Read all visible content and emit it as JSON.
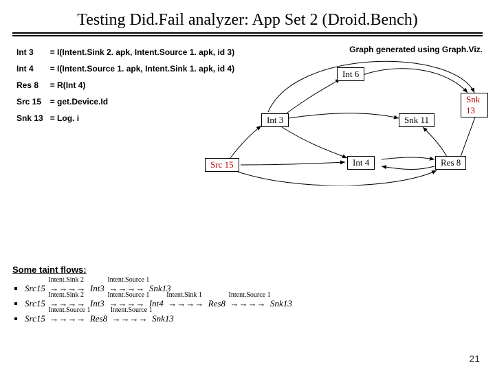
{
  "title": "Testing Did.Fail analyzer: App Set 2 (Droid.Bench)",
  "graph_caption": "Graph generated using Graph.Viz.",
  "defs": [
    {
      "name": "Int 3",
      "rhs": "= I(Intent.Sink 2. apk, Intent.Source 1. apk, id 3)"
    },
    {
      "name": "Int 4",
      "rhs": "= I(Intent.Source 1. apk, Intent.Sink 1. apk, id 4)"
    },
    {
      "name": "Res 8",
      "rhs": "= R(Int 4)"
    },
    {
      "name": "Src 15",
      "rhs": "= get.Device.Id"
    },
    {
      "name": "Snk 13",
      "rhs": "= Log. i"
    }
  ],
  "nodes": {
    "int6": "Int 6",
    "int3": "Int 3",
    "snk11": "Snk 11",
    "snk13": "Snk 13",
    "src15": "Src 15",
    "int4": "Int 4",
    "res8": "Res 8"
  },
  "taint_heading": "Some taint flows:",
  "flows": [
    [
      {
        "node": "Src 15"
      },
      {
        "edge": "Intent.Sink 2"
      },
      {
        "node": "Int 3"
      },
      {
        "edge": "Intent.Source 1"
      },
      {
        "node": "Snk 13"
      }
    ],
    [
      {
        "node": "Src 15"
      },
      {
        "edge": "Intent.Sink 2"
      },
      {
        "node": "Int 3"
      },
      {
        "edge": "Intent.Source 1"
      },
      {
        "node": "Int 4"
      },
      {
        "edge": "Intent.Sink 1"
      },
      {
        "node": "Res 8"
      },
      {
        "edge": "Intent.Source 1"
      },
      {
        "node": "Snk 13"
      }
    ],
    [
      {
        "node": "Src 15"
      },
      {
        "edge": "Intent.Source 1"
      },
      {
        "node": "Res 8"
      },
      {
        "edge": "Intent.Source 1"
      },
      {
        "node": "Snk 13"
      }
    ]
  ],
  "page_number": "21",
  "chart_data": {
    "type": "graph",
    "nodes": [
      "Int 3",
      "Int 4",
      "Int 6",
      "Res 8",
      "Src 15",
      "Snk 11",
      "Snk 13"
    ],
    "highlighted_nodes": [
      "Src 15",
      "Snk 13"
    ],
    "edges": [
      [
        "Int 6",
        "Snk 13"
      ],
      [
        "Int 3",
        "Int 6"
      ],
      [
        "Int 3",
        "Snk 11"
      ],
      [
        "Int 3",
        "Int 4"
      ],
      [
        "Int 3",
        "Snk 13"
      ],
      [
        "Src 15",
        "Int 3"
      ],
      [
        "Src 15",
        "Int 4"
      ],
      [
        "Src 15",
        "Res 8"
      ],
      [
        "Int 4",
        "Res 8"
      ],
      [
        "Res 8",
        "Int 4"
      ],
      [
        "Res 8",
        "Snk 11"
      ],
      [
        "Res 8",
        "Snk 13"
      ]
    ]
  }
}
